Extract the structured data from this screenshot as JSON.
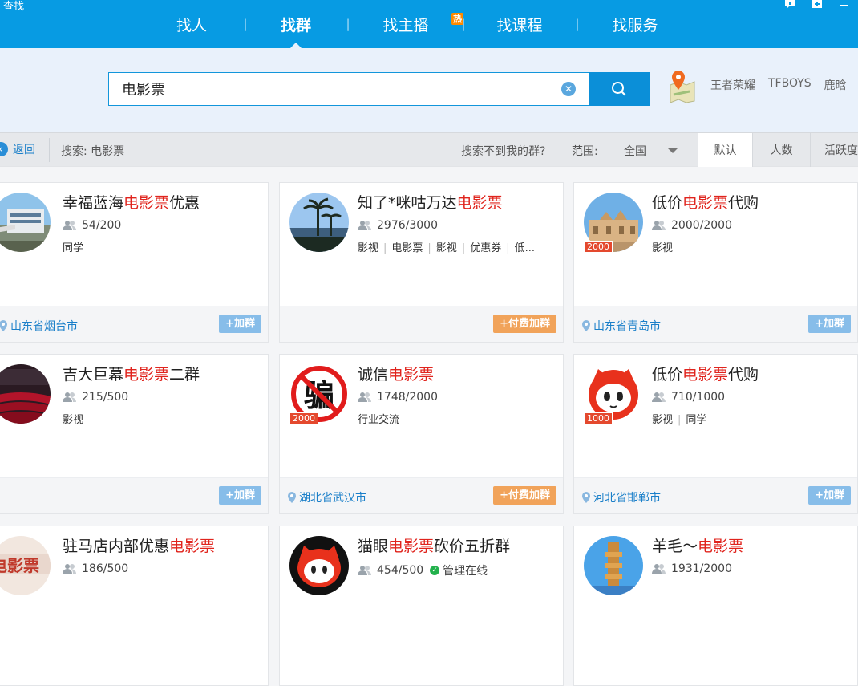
{
  "app": {
    "title": "查找"
  },
  "tabs": [
    {
      "label": "找人"
    },
    {
      "label": "找群"
    },
    {
      "label": "找主播",
      "badge": "热"
    },
    {
      "label": "找课程"
    },
    {
      "label": "找服务"
    }
  ],
  "search": {
    "value": "电影票",
    "clear_icon": "clear-icon",
    "button_icon": "search-icon"
  },
  "hot_words": [
    "王者荣耀",
    "TFBOYS",
    "鹿晗"
  ],
  "filter": {
    "back_label": "返回",
    "search_label": "搜索: 电影票",
    "cant_find": "搜索不到我的群?",
    "scope_label": "范围:",
    "scope_value": "全国",
    "sort_tabs": [
      "默认",
      "人数",
      "活跃度"
    ]
  },
  "colors": {
    "accent": "#079be3",
    "highlight": "#e0241d",
    "join": "#87bde9",
    "paid_join": "#f1a35a",
    "level_badge": "#e4492e"
  },
  "cards": [
    {
      "name_pre": "幸福蓝海",
      "name_hl": "电影票",
      "name_post": "优惠",
      "members": "54/200",
      "tags": [
        "同学"
      ],
      "location": "山东省烟台市",
      "join": "+加群"
    },
    {
      "name_pre": "知了*咪咕万达",
      "name_hl": "电影票",
      "name_post": "",
      "members": "2976/3000",
      "tags": [
        "影视",
        "电影票",
        "影视",
        "优惠券",
        "低..."
      ],
      "location": "",
      "join": "+付费加群"
    },
    {
      "name_pre": "低价",
      "name_hl": "电影票",
      "name_post": "代购",
      "members": "2000/2000",
      "tags": [
        "影视"
      ],
      "location": "山东省青岛市",
      "join": "+加群",
      "level": "2000"
    },
    {
      "name_pre": "吉大巨幕",
      "name_hl": "电影票",
      "name_post": "二群",
      "members": "215/500",
      "tags": [
        "影视"
      ],
      "location": "",
      "join": "+加群"
    },
    {
      "name_pre": "诚信",
      "name_hl": "电影票",
      "name_post": "",
      "members": "1748/2000",
      "tags": [
        "行业交流"
      ],
      "location": "湖北省武汉市",
      "join": "+付费加群",
      "level": "2000",
      "avatar_text": "骗"
    },
    {
      "name_pre": "低价",
      "name_hl": "电影票",
      "name_post": "代购",
      "members": "710/1000",
      "tags": [
        "影视",
        "同学"
      ],
      "location": "河北省邯郸市",
      "join": "+加群",
      "level": "1000"
    },
    {
      "name_pre": "驻马店内部优惠",
      "name_hl": "电影票",
      "name_post": "",
      "members": "186/500",
      "tags": [],
      "location": "",
      "join": "",
      "avatar_text": "电影票"
    },
    {
      "name_pre": "猫眼",
      "name_hl": "电影票",
      "name_post": "砍价五折群",
      "members": "454/500",
      "tags": [],
      "location": "",
      "join": "",
      "online": "管理在线"
    },
    {
      "name_pre": "羊毛～",
      "name_hl": "电影票",
      "name_post": "",
      "members": "1931/2000",
      "tags": [],
      "location": "",
      "join": ""
    }
  ]
}
